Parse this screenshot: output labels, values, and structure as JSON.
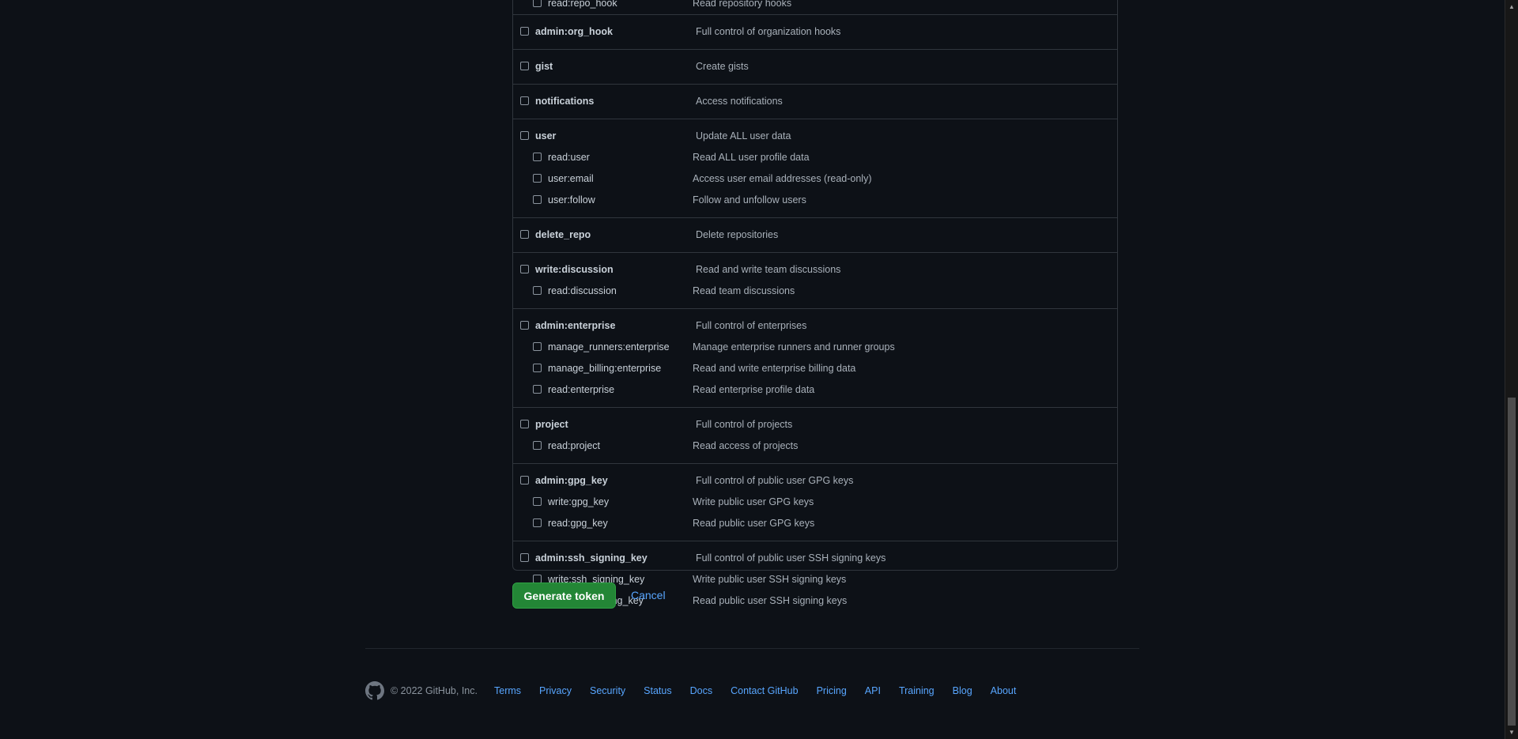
{
  "scopes": {
    "partial_top": {
      "name": "read:repo_hook",
      "desc": "Read repository hooks"
    },
    "groups": [
      {
        "name": "admin:org_hook",
        "desc": "Full control of organization hooks",
        "children": []
      },
      {
        "name": "gist",
        "desc": "Create gists",
        "children": []
      },
      {
        "name": "notifications",
        "desc": "Access notifications",
        "children": []
      },
      {
        "name": "user",
        "desc": "Update ALL user data",
        "children": [
          {
            "name": "read:user",
            "desc": "Read ALL user profile data"
          },
          {
            "name": "user:email",
            "desc": "Access user email addresses (read-only)"
          },
          {
            "name": "user:follow",
            "desc": "Follow and unfollow users"
          }
        ]
      },
      {
        "name": "delete_repo",
        "desc": "Delete repositories",
        "children": []
      },
      {
        "name": "write:discussion",
        "desc": "Read and write team discussions",
        "children": [
          {
            "name": "read:discussion",
            "desc": "Read team discussions"
          }
        ]
      },
      {
        "name": "admin:enterprise",
        "desc": "Full control of enterprises",
        "children": [
          {
            "name": "manage_runners:enterprise",
            "desc": "Manage enterprise runners and runner groups"
          },
          {
            "name": "manage_billing:enterprise",
            "desc": "Read and write enterprise billing data"
          },
          {
            "name": "read:enterprise",
            "desc": "Read enterprise profile data"
          }
        ]
      },
      {
        "name": "project",
        "desc": "Full control of projects",
        "children": [
          {
            "name": "read:project",
            "desc": "Read access of projects"
          }
        ]
      },
      {
        "name": "admin:gpg_key",
        "desc": "Full control of public user GPG keys",
        "children": [
          {
            "name": "write:gpg_key",
            "desc": "Write public user GPG keys"
          },
          {
            "name": "read:gpg_key",
            "desc": "Read public user GPG keys"
          }
        ]
      },
      {
        "name": "admin:ssh_signing_key",
        "desc": "Full control of public user SSH signing keys",
        "children": [
          {
            "name": "write:ssh_signing_key",
            "desc": "Write public user SSH signing keys"
          },
          {
            "name": "read:ssh_signing_key",
            "desc": "Read public user SSH signing keys"
          }
        ]
      }
    ]
  },
  "actions": {
    "generate_label": "Generate token",
    "cancel_label": "Cancel"
  },
  "footer": {
    "copyright": "© 2022 GitHub, Inc.",
    "links": [
      "Terms",
      "Privacy",
      "Security",
      "Status",
      "Docs",
      "Contact GitHub",
      "Pricing",
      "API",
      "Training",
      "Blog",
      "About"
    ]
  },
  "colors": {
    "background": "#0d1117",
    "border": "#30363d",
    "text": "#c9d1d9",
    "muted": "#8b949e",
    "link": "#58a6ff",
    "primary_button": "#238636"
  },
  "icons": {
    "footer_logo": "github-mark-icon",
    "scroll_up": "scroll-up-arrow-icon",
    "scroll_down": "scroll-down-arrow-icon"
  }
}
